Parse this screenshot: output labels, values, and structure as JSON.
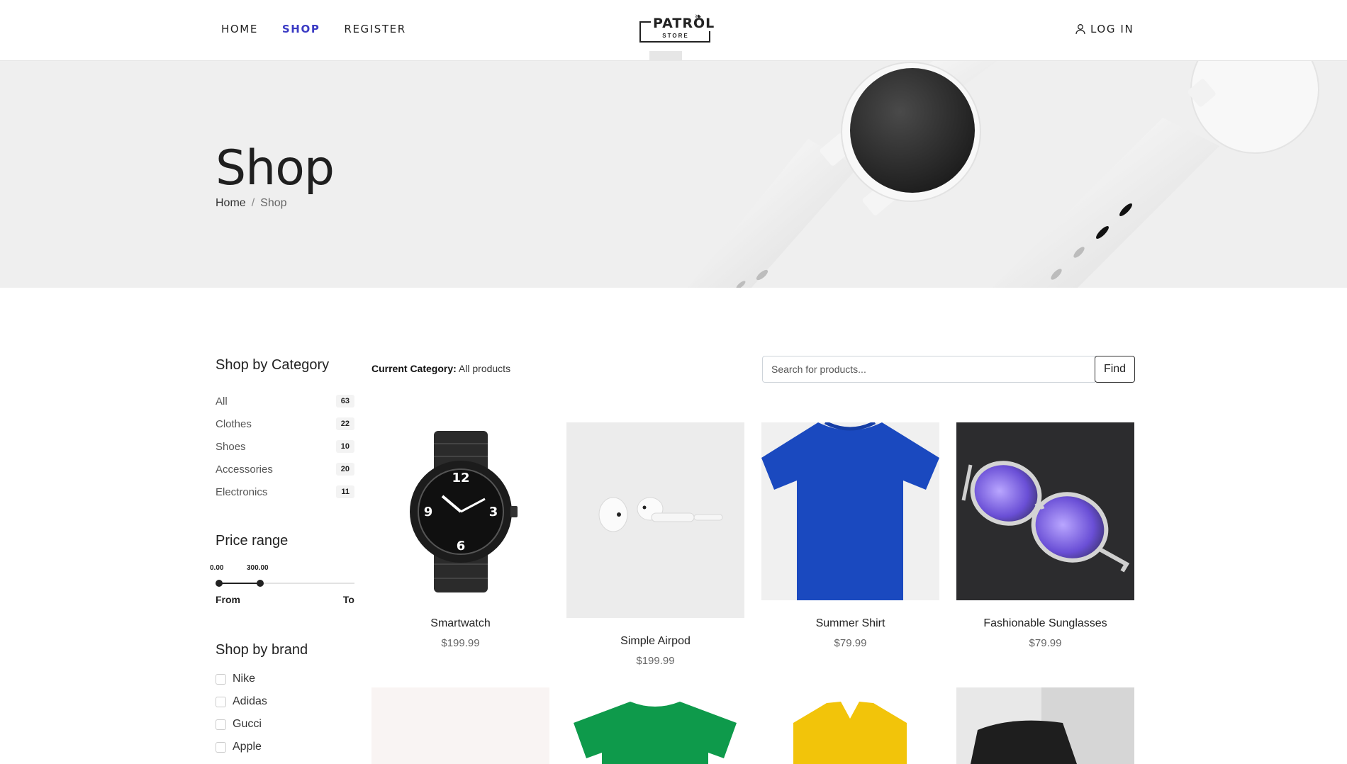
{
  "nav": {
    "items": [
      {
        "label": "HOME",
        "active": false
      },
      {
        "label": "SHOP",
        "active": true
      },
      {
        "label": "REGISTER",
        "active": false
      }
    ],
    "login_label": "LOG IN"
  },
  "logo": {
    "line1": "PATROL",
    "line2": "STORE"
  },
  "hero": {
    "title": "Shop",
    "breadcrumb": {
      "home": "Home",
      "separator": "/",
      "current": "Shop"
    }
  },
  "sidebar": {
    "category_heading": "Shop by Category",
    "categories": [
      {
        "label": "All",
        "count": "63"
      },
      {
        "label": "Clothes",
        "count": "22"
      },
      {
        "label": "Shoes",
        "count": "10"
      },
      {
        "label": "Accessories",
        "count": "20"
      },
      {
        "label": "Electronics",
        "count": "11"
      }
    ],
    "price_heading": "Price range",
    "price": {
      "min_value": "0.00",
      "max_value": "300.00",
      "from_label": "From",
      "to_label": "To",
      "selected_fraction": [
        0.0,
        0.3
      ]
    },
    "brand_heading": "Shop by brand",
    "brands": [
      "Nike",
      "Adidas",
      "Gucci",
      "Apple"
    ]
  },
  "main": {
    "current_category_label": "Current Category:",
    "current_category_value": "All products",
    "search_placeholder": "Search for products...",
    "find_label": "Find",
    "products": [
      {
        "name": "Smartwatch",
        "price": "$199.99"
      },
      {
        "name": "Simple Airpod",
        "price": "$199.99"
      },
      {
        "name": "Summer Shirt",
        "price": "$79.99"
      },
      {
        "name": "Fashionable Sunglasses",
        "price": "$79.99"
      }
    ]
  },
  "colors": {
    "accent": "#3b3bc4",
    "hero_bg": "#efefef",
    "text": "#222222"
  }
}
